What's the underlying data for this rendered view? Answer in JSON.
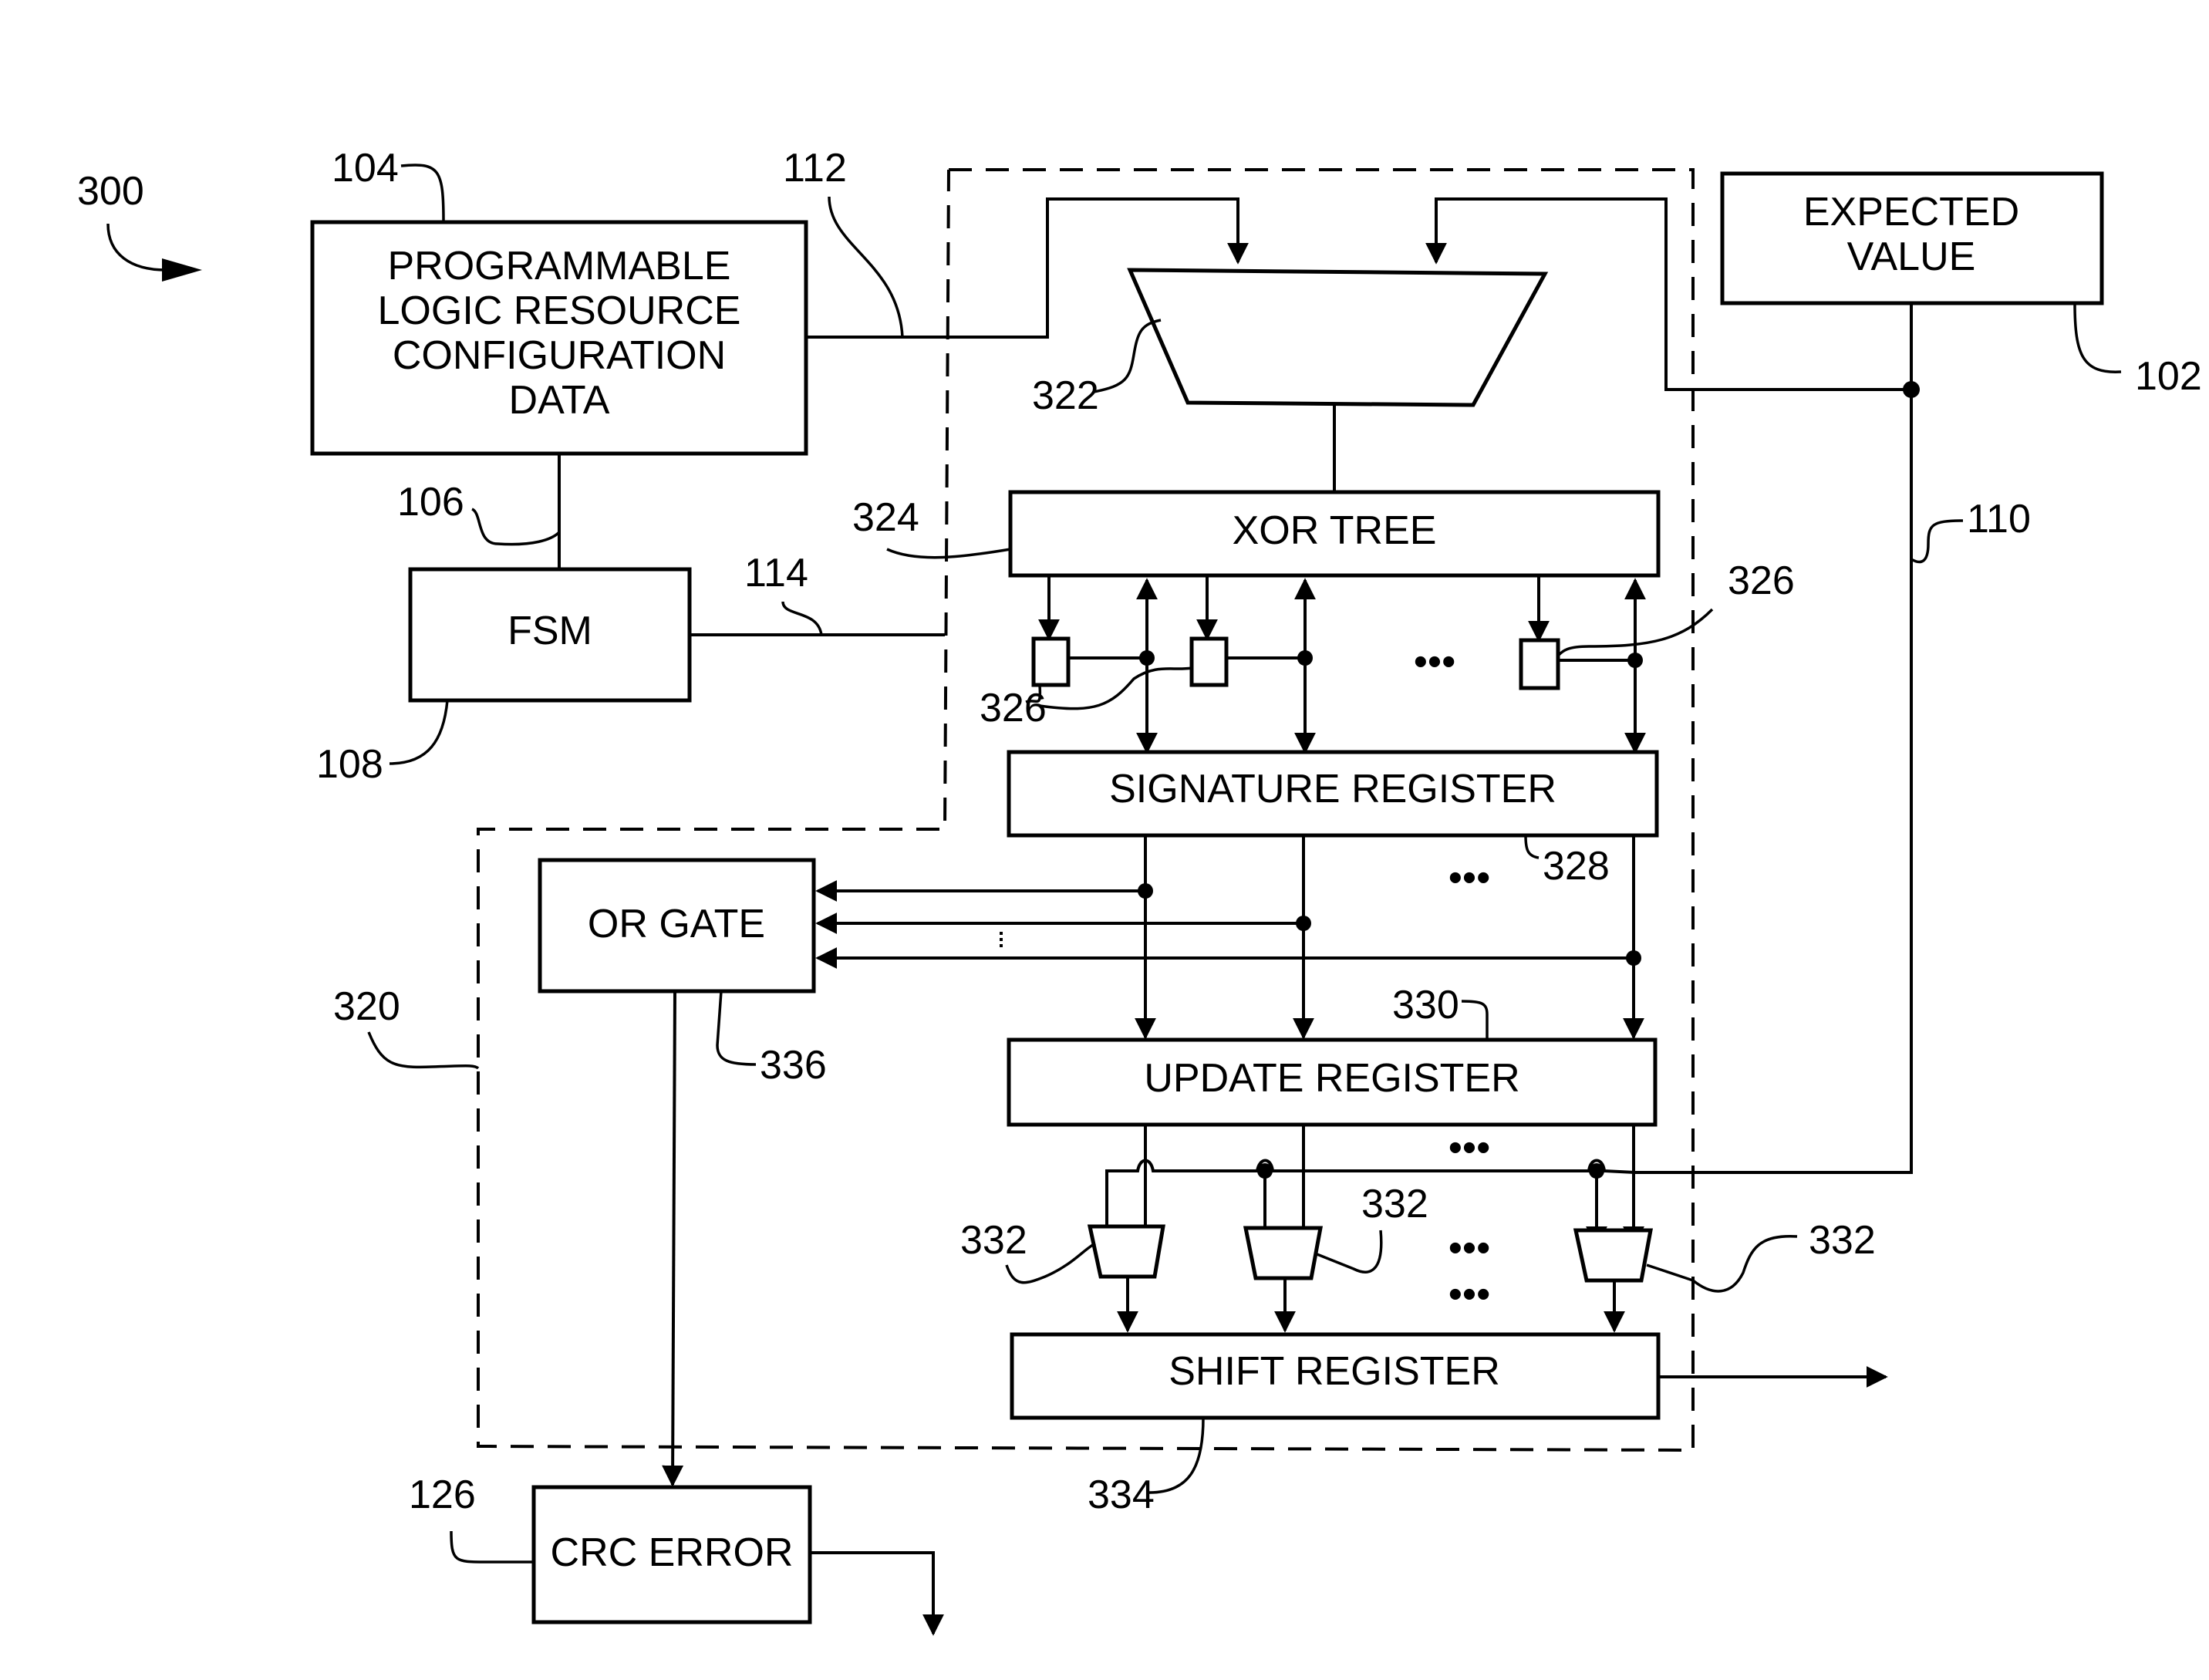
{
  "figure": {
    "ref": "300",
    "blocks": {
      "config_data": {
        "ref": "104",
        "lines": [
          "PROGRAMMABLE",
          "LOGIC RESOURCE",
          "CONFIGURATION",
          "DATA"
        ]
      },
      "fsm": {
        "ref": "108",
        "label": "FSM"
      },
      "expected_value": {
        "ref": "102",
        "lines": [
          "EXPECTED",
          "VALUE"
        ]
      },
      "mux_top": {
        "ref": "322"
      },
      "xor_tree": {
        "ref": "324",
        "label": "XOR TREE"
      },
      "flipflops": {
        "ref": "326"
      },
      "signature_register": {
        "ref": "328",
        "label": "SIGNATURE REGISTER"
      },
      "or_gate": {
        "ref": "336",
        "label": "OR GATE"
      },
      "update_register": {
        "ref": "330",
        "label": "UPDATE REGISTER"
      },
      "muxes": {
        "ref": "332"
      },
      "shift_register": {
        "ref": "334",
        "label": "SHIFT REGISTER"
      },
      "crc_error": {
        "ref": "126",
        "label": "CRC ERROR"
      }
    },
    "buses": {
      "config_bus": "112",
      "config_fsm": "106",
      "fsm_bus": "114",
      "expected_bus": "110"
    },
    "regions": {
      "crc_circuit": "320"
    },
    "ellipsis": "•••"
  }
}
